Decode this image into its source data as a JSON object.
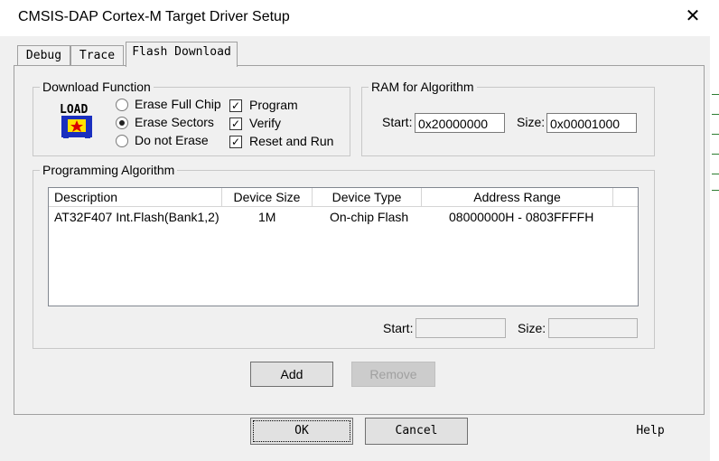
{
  "window": {
    "title": "CMSIS-DAP Cortex-M Target Driver Setup",
    "close_glyph": "✕"
  },
  "tabs": [
    {
      "label": "Debug"
    },
    {
      "label": "Trace"
    },
    {
      "label": "Flash Download"
    }
  ],
  "download_function": {
    "group_label": "Download Function",
    "icon_text": "LOAD",
    "radios": [
      {
        "label": "Erase Full Chip",
        "checked": false
      },
      {
        "label": "Erase Sectors",
        "checked": true
      },
      {
        "label": "Do not Erase",
        "checked": false
      }
    ],
    "checks": [
      {
        "label": "Program",
        "checked": true
      },
      {
        "label": "Verify",
        "checked": true
      },
      {
        "label": "Reset and Run",
        "checked": true
      }
    ]
  },
  "ram": {
    "group_label": "RAM for Algorithm",
    "start_label": "Start:",
    "start_value": "0x20000000",
    "size_label": "Size:",
    "size_value": "0x00001000"
  },
  "programming": {
    "group_label": "Programming Algorithm",
    "columns": [
      "Description",
      "Device Size",
      "Device Type",
      "Address Range"
    ],
    "rows": [
      {
        "description": "AT32F407 Int.Flash(Bank1,2)",
        "device_size": "1M",
        "device_type": "On-chip Flash",
        "address_range": "08000000H - 0803FFFFH"
      }
    ],
    "start_label": "Start:",
    "start_value": "",
    "size_label": "Size:",
    "size_value": ""
  },
  "buttons": {
    "add": "Add",
    "remove": "Remove",
    "ok": "OK",
    "cancel": "Cancel",
    "help": "Help"
  }
}
